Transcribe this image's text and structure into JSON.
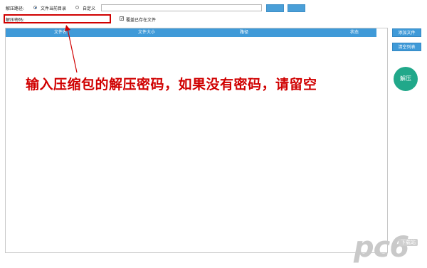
{
  "top": {
    "path_label": "解压路径:",
    "radio_current_dir": "文件当前目录",
    "radio_custom": "自定义",
    "path_value": "",
    "password_label": "解压密码:",
    "password_value": "",
    "overwrite_label": "覆盖已存在文件",
    "overwrite_checked": "✓"
  },
  "table": {
    "columns": [
      "文件名",
      "文件大小",
      "路径",
      "状态"
    ]
  },
  "side": {
    "add_files": "添加文件",
    "clear_list": "清空列表",
    "extract": "解压"
  },
  "annotation": {
    "text": "输入压缩包的解压密码，如果没有密码，请留空",
    "color": "#d00000"
  },
  "watermark": {
    "logo": "pc6",
    "tag": "下载站"
  }
}
